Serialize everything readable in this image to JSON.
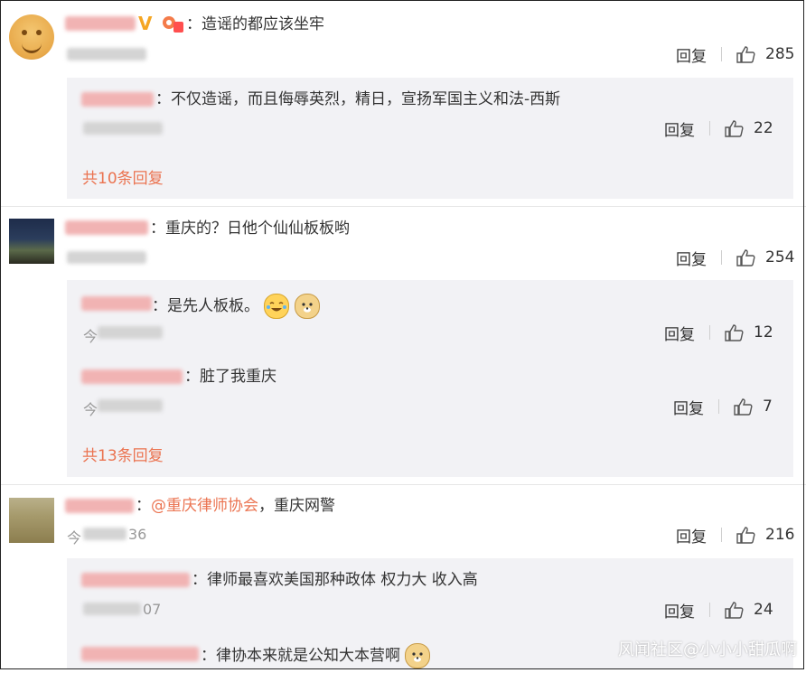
{
  "thread1": {
    "comment_text": "：造谣的都应该坐牢",
    "badge_v": "V",
    "reply_label": "回复",
    "likes": "285",
    "reply": {
      "text": "：不仅造谣，而且侮辱英烈，精日，宣扬军国主义和法-西斯",
      "reply_label": "回复",
      "likes": "22"
    },
    "more_replies": "共10条回复"
  },
  "thread2": {
    "comment_text": "：重庆的？日他个仙仙板板哟",
    "reply_label": "回复",
    "likes": "254",
    "replies": [
      {
        "text": "：是先人板板。",
        "time_prefix": "今",
        "reply_label": "回复",
        "likes": "12"
      },
      {
        "text": "：脏了我重庆",
        "time_prefix": "今",
        "reply_label": "回复",
        "likes": "7"
      }
    ],
    "more_replies": "共13条回复"
  },
  "thread3": {
    "mention": "@重庆律师协会",
    "comment_text": "，重庆网警",
    "colon": "：",
    "time_prefix": "今",
    "time_suffix": "36",
    "reply_label": "回复",
    "likes": "216",
    "replies": [
      {
        "text": "：律师最喜欢美国那种政体 权力大 收入高",
        "time_suffix": "07",
        "reply_label": "回复",
        "likes": "24"
      },
      {
        "text": "：律协本来就是公知大本营啊"
      }
    ]
  },
  "watermark": "风闻社区@小小小甜瓜啊",
  "colors": {
    "accent": "#eb7350",
    "panel_bg": "#f2f2f5",
    "text": "#333333",
    "muted": "#999999"
  },
  "icons": [
    "thumbs-up-icon",
    "vip-v-icon",
    "crying-laugh-emoji-icon",
    "doge-emoji-icon"
  ]
}
